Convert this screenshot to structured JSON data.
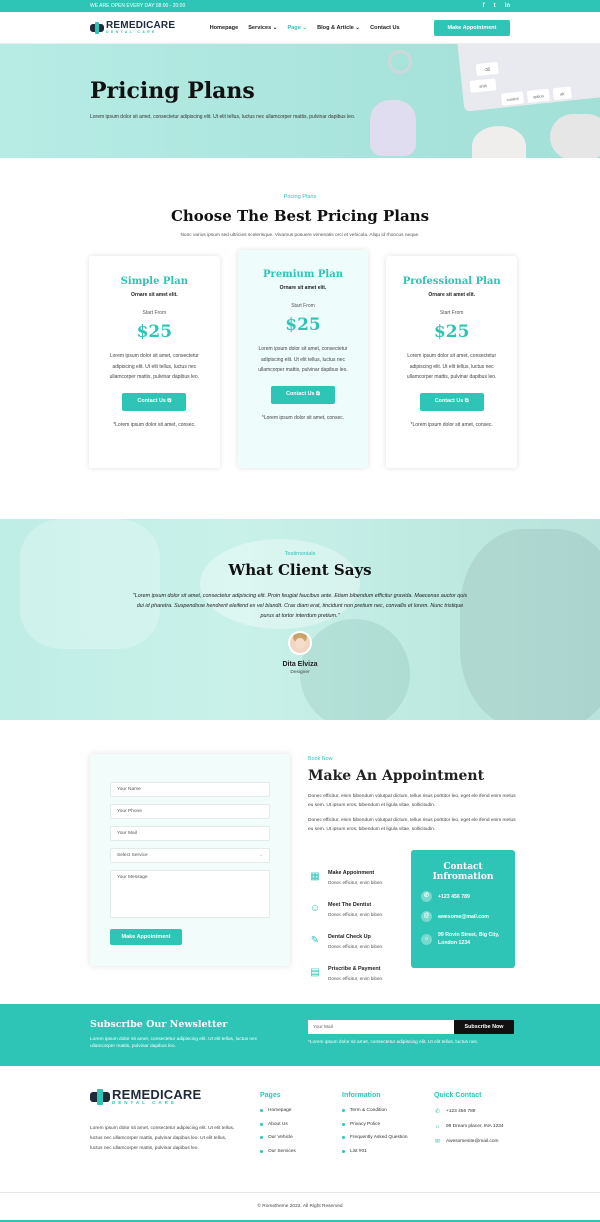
{
  "topbar": {
    "open_text": "WE ARE OPEN EVERY DAY  08:00 - 20:00",
    "socials": [
      "f",
      "t",
      "in"
    ]
  },
  "brand": {
    "name": "REMEDICARE",
    "tagline": "DENTAL CARE"
  },
  "nav": {
    "items": [
      "Homepage",
      "Services ⌄",
      "Page ⌄",
      "Blog & Article ⌄",
      "Contact Us"
    ],
    "active_index": 2,
    "cta": "Make Appointment"
  },
  "hero": {
    "title": "Pricing Plans",
    "subtitle": "Lorem ipsum dolor sit amet, consectetur adipiscing elit. Ut elit tellus, luctus nec ullamcorper mattis, pulvinar dapibus leo.",
    "keys": [
      "⌫",
      "shift",
      "control",
      "option",
      "alt"
    ]
  },
  "pricing": {
    "eyebrow": "Pricing Plans",
    "title": "Choose The Best Pricing Plans",
    "subtitle": "Nunc varius ipsum sed ultricies scelerisque. Vivamus posuere venenatis orci et vehicula. Aliqu id rhoncus neque.",
    "plans": [
      {
        "name": "Simple Plan",
        "tag": "Ornare sit amet elit.",
        "from": "Start From",
        "price": "$25",
        "desc": "Lorem ipsum dolor sit amet, consectetur adipiscing elit. Ut elit tellus, luctus nec ullamcorper mattis, pulvinar dapibus leo.",
        "button": "Contact Us ⧉",
        "note": "*Lorem ipsum dolor sit amet, consec."
      },
      {
        "name": "Premium Plan",
        "tag": "Ornare sit amet elit.",
        "from": "Start From",
        "price": "$25",
        "desc": "Lorem ipsum dolor sit amet, consectetur adipiscing elit. Ut elit tellus, luctus nec ullamcorper mattis, pulvinar dapibus leo.",
        "button": "Contact Us ⧉",
        "note": "*Lorem ipsum dolor sit amet, consec."
      },
      {
        "name": "Professional Plan",
        "tag": "Ornare sit amet elit.",
        "from": "Start From",
        "price": "$25",
        "desc": "Lorem ipsum dolor sit amet, consectetur adipiscing elit. Ut elit tellus, luctus nec ullamcorper mattis, pulvinar dapibus leo.",
        "button": "Contact Us ⧉",
        "note": "*Lorem ipsum dolor sit amet, consec."
      }
    ]
  },
  "testimonials": {
    "eyebrow": "Testimonials",
    "title": "What Client Says",
    "quote": "\"Lorem ipsum dolor sit amet, consectetur adipiscing elit. Proin feugiat faucibus ante. Etiam bibendum efficitur gravida. Maecenas auctor quis dui id pharetra. Suspendisse hendrerit eleifend ex vel blandit. Cras diam erat, tincidunt non pretium nec, convallis et lorem. Nunc tristique purus at tortor interdum pretium.\"",
    "name": "Dita Elviza",
    "role": "Designer"
  },
  "appointment": {
    "form": {
      "name_placeholder": "Your Name",
      "phone_placeholder": "Your Phone",
      "mail_placeholder": "Your Mail",
      "service_placeholder": "Select Service",
      "message_placeholder": "Your Message",
      "submit": "Make Appointment"
    },
    "eyebrow": "Book Now",
    "title": "Make An Appointment",
    "para1": "Donec efficitur, enim bibendum volutpat dictum, tellus risus porttitor leo, eget ele ifend enim metus eu sem. Ut ipsum eros, bibendum et ligula vitae, sollicitudin.",
    "para2": "Donec efficitur, enim bibendum volutpat dictum, tellus risus porttitor leo, eget ele ifend enim metus eu sem. Ut ipsum eros, bibendum et ligula vitae, sollicitudin.",
    "steps": [
      {
        "title": "Make Appoinment",
        "desc": "Donec efficitur, enim biben.",
        "icon": "calendar-icon"
      },
      {
        "title": "Meet The Dentist",
        "desc": "Donec efficitur, enim biben.",
        "icon": "doctor-icon"
      },
      {
        "title": "Dental Check Up",
        "desc": "Donec efficitur, enim biben.",
        "icon": "dental-tool-icon"
      },
      {
        "title": "Priscribe & Payment",
        "desc": "Donec efficitur, enim biben.",
        "icon": "receipt-icon"
      }
    ],
    "contact": {
      "title": "Contact Infromation",
      "phone": "+123 456 789",
      "email": "awesome@mail.com",
      "address": "99 Rovin Street, Big City, London 1234"
    }
  },
  "newsletter": {
    "title": "Subscribe Our Newsletter",
    "text": "Lorem ipsum dolor sit amet, consectetur adipiscing elit. Ut elit tellus, luctus nec ullamcorper mattis, pulvinar dapibus leo.",
    "placeholder": "Your Mail",
    "button": "Subscribe Now",
    "note": "*Lorem ipsum dolor sit amet, consectetur adipiscing elit. Ut elit tellus, luctus nec."
  },
  "footer": {
    "about": "Lorem ipsum dolor sit amet, consectetur adipiscing elit. Ut elit tellus, luctus nec ullamcorper mattis, pulvinar dapibus leo. Ut elit tellus, luctus nec ullamcorper mattis, pulvinar dapibus leo.",
    "pages_title": "Pages",
    "pages": [
      "Homepage",
      "About Us",
      "Our Vehicle",
      "Our Services"
    ],
    "info_title": "Information",
    "info": [
      "Term & Condition",
      "Privacy Police",
      "Frequently Asked Question",
      "List #01"
    ],
    "contact_title": "Quick Contact",
    "contact": [
      "+123 456 789",
      "99 Dream placer, INA 1234",
      "Awesomesite@mail.com"
    ],
    "copyright": "©  Rometheme 2022. All Right Reserved"
  },
  "colors": {
    "accent": "#2ec4b6",
    "dark": "#1f2b3a"
  }
}
